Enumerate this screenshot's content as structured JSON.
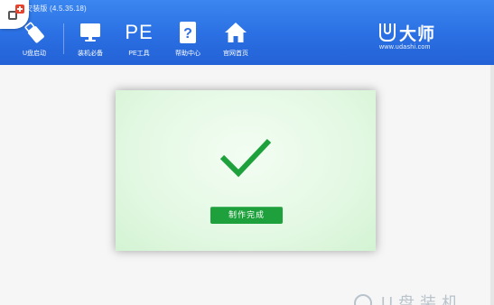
{
  "window": {
    "title": "安装版 (4.5.35.18)"
  },
  "nav": {
    "items": [
      {
        "label": "U盘启动",
        "icon": "usb-drive-icon"
      },
      {
        "label": "装机必备",
        "icon": "monitor-icon"
      },
      {
        "label": "PE工具",
        "icon": "pe-text-icon",
        "glyph": "PE"
      },
      {
        "label": "帮助中心",
        "icon": "help-question-icon"
      },
      {
        "label": "官网首页",
        "icon": "home-icon"
      }
    ]
  },
  "brand": {
    "name": "大师",
    "url": "www.udashi.com"
  },
  "dialog": {
    "status_icon": "checkmark-icon",
    "button_label": "制作完成"
  },
  "watermark": {
    "text": "U盘装机"
  },
  "colors": {
    "header_blue": "#2a6fe3",
    "success_green": "#1ea13c",
    "dialog_bg": "#e3f8e3"
  }
}
